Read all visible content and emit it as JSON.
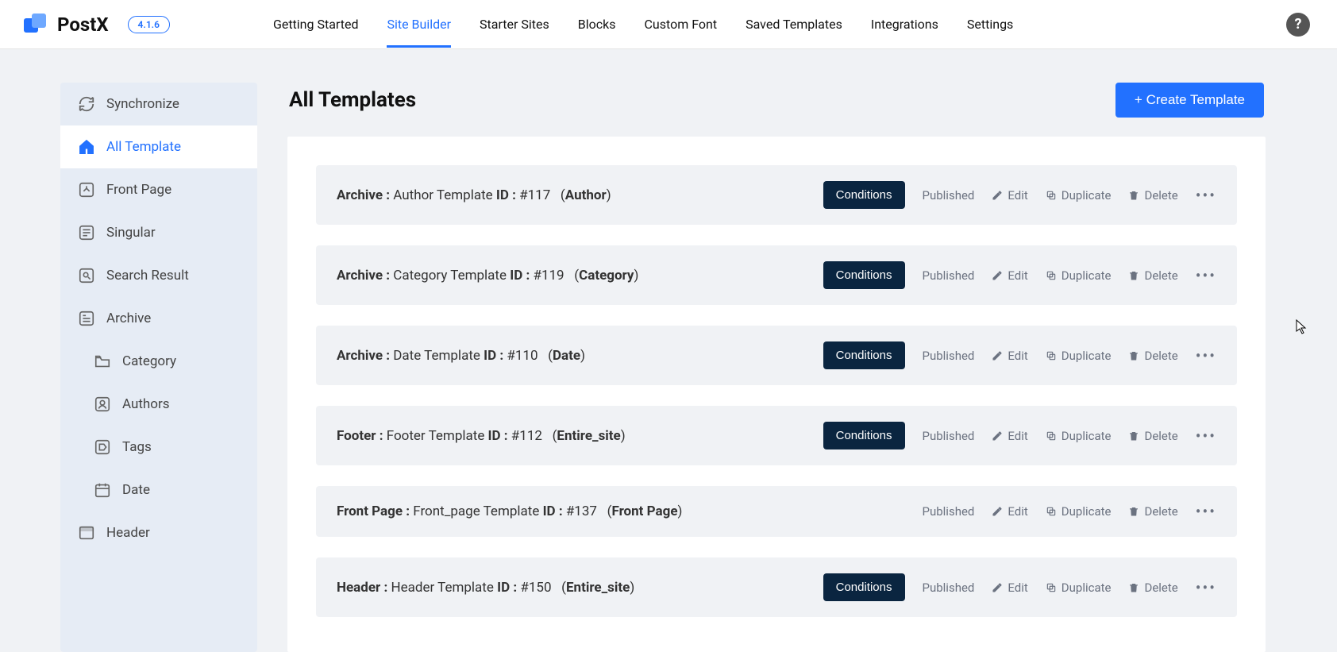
{
  "brand": {
    "name": "PostX",
    "version": "4.1.6"
  },
  "topnav": [
    {
      "label": "Getting Started",
      "active": false
    },
    {
      "label": "Site Builder",
      "active": true
    },
    {
      "label": "Starter Sites",
      "active": false
    },
    {
      "label": "Blocks",
      "active": false
    },
    {
      "label": "Custom Font",
      "active": false
    },
    {
      "label": "Saved Templates",
      "active": false
    },
    {
      "label": "Integrations",
      "active": false
    },
    {
      "label": "Settings",
      "active": false
    }
  ],
  "sidebar": [
    {
      "label": "Synchronize",
      "icon": "sync",
      "active": false,
      "sub": false
    },
    {
      "label": "All Template",
      "icon": "home",
      "active": true,
      "sub": false
    },
    {
      "label": "Front Page",
      "icon": "front",
      "active": false,
      "sub": false
    },
    {
      "label": "Singular",
      "icon": "singular",
      "active": false,
      "sub": false
    },
    {
      "label": "Search Result",
      "icon": "search",
      "active": false,
      "sub": false
    },
    {
      "label": "Archive",
      "icon": "archive",
      "active": false,
      "sub": false
    },
    {
      "label": "Category",
      "icon": "folder",
      "active": false,
      "sub": true
    },
    {
      "label": "Authors",
      "icon": "authors",
      "active": false,
      "sub": true
    },
    {
      "label": "Tags",
      "icon": "tags",
      "active": false,
      "sub": true
    },
    {
      "label": "Date",
      "icon": "date",
      "active": false,
      "sub": true
    },
    {
      "label": "Header",
      "icon": "header",
      "active": false,
      "sub": false
    }
  ],
  "page": {
    "title": "All Templates",
    "create_label": "+ Create Template"
  },
  "actions": {
    "conditions": "Conditions",
    "published": "Published",
    "edit": "Edit",
    "duplicate": "Duplicate",
    "delete": "Delete"
  },
  "templates": [
    {
      "type": "Archive",
      "name": "Author Template",
      "id": "#117",
      "scope": "Author",
      "has_conditions": true
    },
    {
      "type": "Archive",
      "name": "Category Template",
      "id": "#119",
      "scope": "Category",
      "has_conditions": true
    },
    {
      "type": "Archive",
      "name": "Date Template",
      "id": "#110",
      "scope": "Date",
      "has_conditions": true
    },
    {
      "type": "Footer",
      "name": "Footer Template",
      "id": "#112",
      "scope": "Entire_site",
      "has_conditions": true
    },
    {
      "type": "Front Page",
      "name": "Front_page Template",
      "id": "#137",
      "scope": "Front Page",
      "has_conditions": false
    },
    {
      "type": "Header",
      "name": "Header Template",
      "id": "#150",
      "scope": "Entire_site",
      "has_conditions": true
    }
  ]
}
